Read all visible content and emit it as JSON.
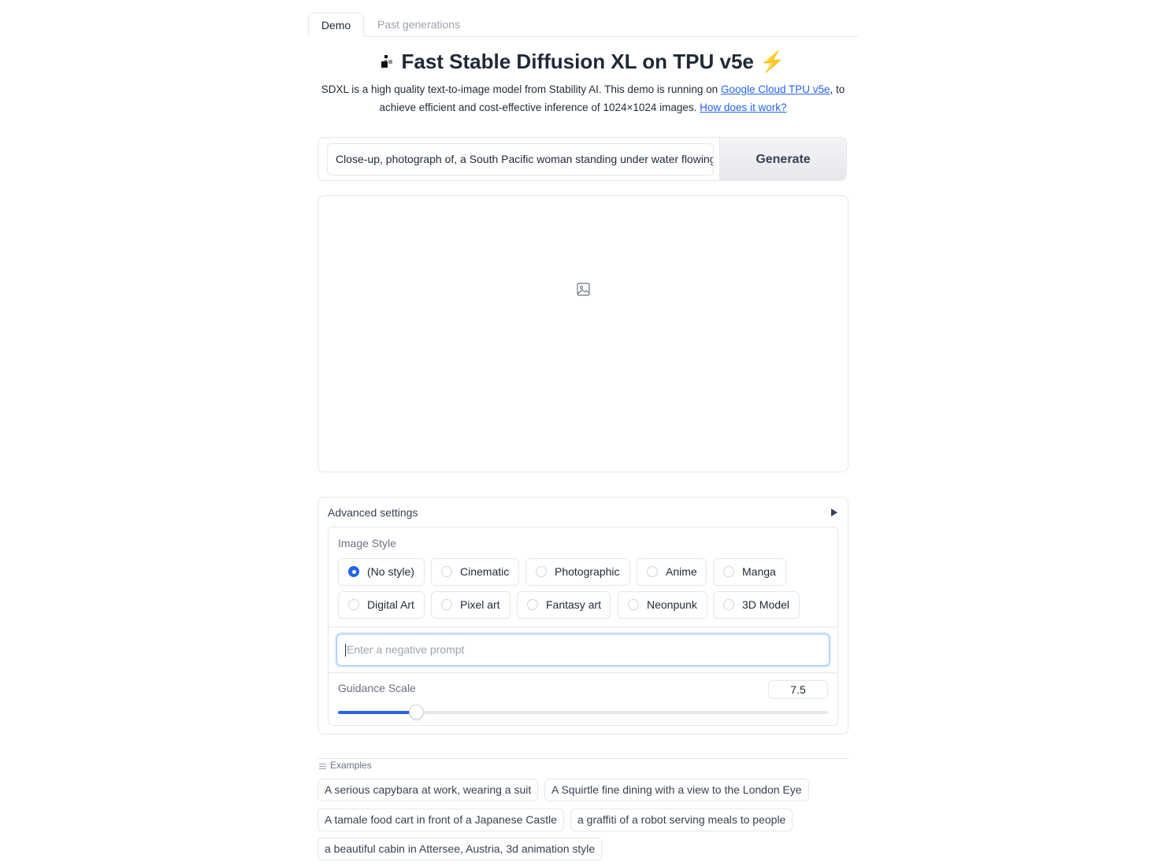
{
  "tabs": [
    {
      "label": "Demo"
    },
    {
      "label": "Past generations"
    }
  ],
  "header": {
    "title": "Fast Stable Diffusion XL on TPU v5e",
    "title_suffix": "⚡",
    "description_before": "SDXL is a high quality text-to-image model from Stability AI. This demo is running on ",
    "link_tpu": "Google Cloud TPU v5e",
    "description_middle": ", to achieve efficient and cost-effective inference of 1024×1024 images. ",
    "link_how": "How does it work?"
  },
  "prompt": {
    "value": "Close-up, photograph of, a South Pacific woman standing under water flowing from a waterfall",
    "generate_label": "Generate"
  },
  "advanced": {
    "title": "Advanced settings",
    "image_style_label": "Image Style",
    "styles": [
      "(No style)",
      "Cinematic",
      "Photographic",
      "Anime",
      "Manga",
      "Digital Art",
      "Pixel art",
      "Fantasy art",
      "Neonpunk",
      "3D Model"
    ],
    "selected_style": "(No style)",
    "negative_placeholder": "Enter a negative prompt",
    "guidance_label": "Guidance Scale",
    "guidance_value": "7.5",
    "guidance_fraction": 0.16
  },
  "examples": {
    "label": "Examples",
    "items": [
      "A serious capybara at work, wearing a suit",
      "A Squirtle fine dining with a view to the London Eye",
      "A tamale food cart in front of a Japanese Castle",
      "a graffiti of a robot serving meals to people",
      "a beautiful cabin in Attersee, Austria, 3d animation style"
    ]
  },
  "colors": {
    "accent": "#2563eb",
    "border": "#e5e7eb"
  }
}
